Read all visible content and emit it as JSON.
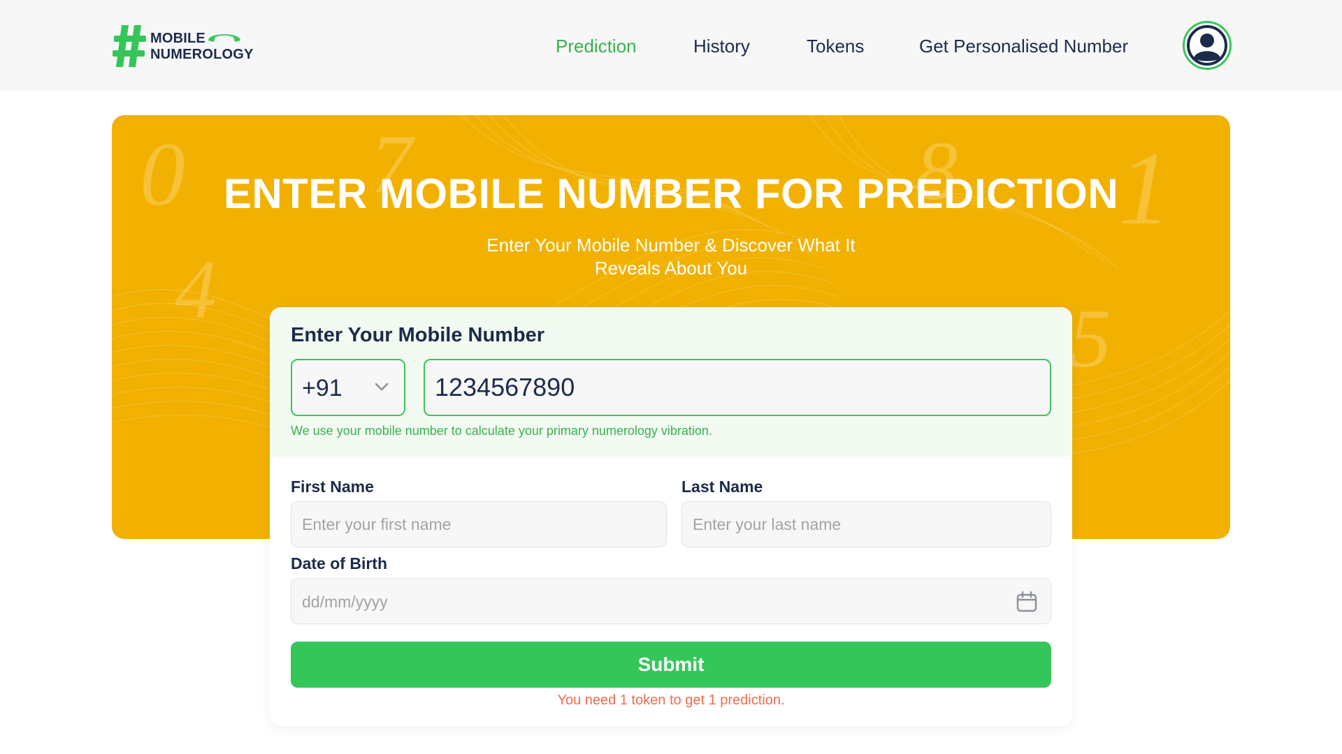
{
  "brand": {
    "line1": "MOBILE",
    "line2": "NUMEROLOGY",
    "accent_color": "#35c65a",
    "text_color": "#1b2b4b"
  },
  "nav": {
    "items": [
      {
        "label": "Prediction",
        "active": true
      },
      {
        "label": "History",
        "active": false
      },
      {
        "label": "Tokens",
        "active": false
      },
      {
        "label": "Get Personalised Number",
        "active": false
      }
    ],
    "avatar_icon": "user-avatar-icon"
  },
  "hero": {
    "title": "ENTER MOBILE NUMBER FOR PREDICTION",
    "subtitle": "Enter Your Mobile Number & Discover What It Reveals About You",
    "background_color": "#f2b100",
    "decor_digits": [
      "0",
      "7",
      "8",
      "1",
      "4",
      "5"
    ]
  },
  "form": {
    "heading": "Enter Your Mobile Number",
    "country_code": "+91",
    "phone_value": "1234567890",
    "phone_hint": "We use your mobile number to calculate your primary numerology vibration.",
    "first_name_label": "First Name",
    "first_name_placeholder": "Enter your first name",
    "last_name_label": "Last Name",
    "last_name_placeholder": "Enter your last name",
    "dob_label": "Date of Birth",
    "dob_placeholder": "dd/mm/yyyy",
    "submit_label": "Submit",
    "token_note": "You need 1 token to get 1 prediction.",
    "hint_color": "#37b24d",
    "note_color": "#ef6b4c"
  }
}
